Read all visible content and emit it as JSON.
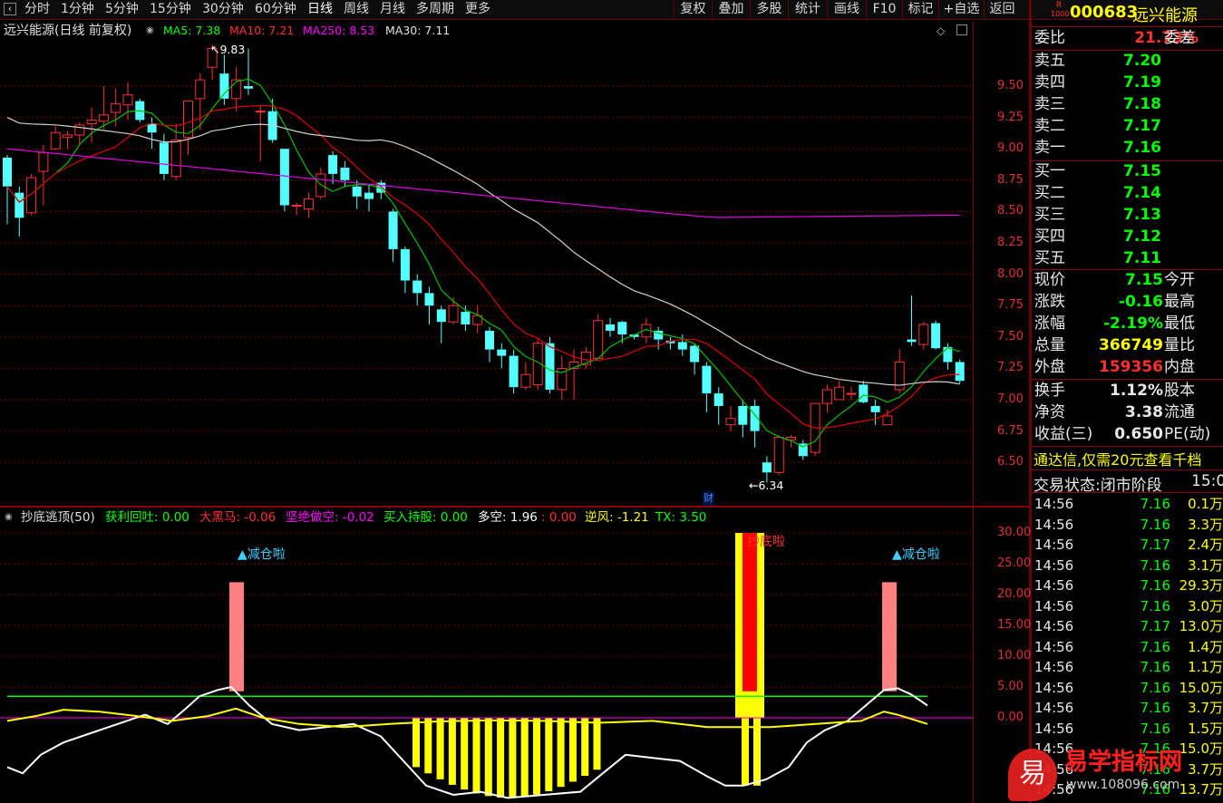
{
  "toolbar": {
    "periods": [
      "分时",
      "1分钟",
      "5分钟",
      "15分钟",
      "30分钟",
      "60分钟",
      "日线",
      "周线",
      "月线",
      "多周期",
      "更多"
    ],
    "active": "日线",
    "right_buttons": [
      "复权",
      "叠加",
      "多股",
      "统计",
      "画线",
      "F10",
      "标记",
      "+自选",
      "返回"
    ]
  },
  "main_chart": {
    "title": "远兴能源(日线 前复权)",
    "ma5": "MA5: 7.38",
    "ma10": "MA10: 7.21",
    "ma250": "MA250: 8.53",
    "ma30": "MA30: 7.11",
    "high_label": "9.83",
    "low_label": "6.34",
    "fin_marker": "财",
    "y_labels": [
      "9.50",
      "9.25",
      "9.00",
      "8.75",
      "8.50",
      "8.25",
      "8.00",
      "7.75",
      "7.50",
      "7.25",
      "7.00",
      "6.75",
      "6.50"
    ]
  },
  "indicator": {
    "title": "抄底逃顶(50)",
    "items": [
      {
        "text": "获利回吐: 0.00",
        "color": "#00ff00"
      },
      {
        "text": "大黑马: -0.06",
        "color": "#ff3030"
      },
      {
        "text": "坚绝做空: -0.02",
        "color": "#ff00ff"
      },
      {
        "text": "买入持股: 0.00",
        "color": "#00ff00"
      },
      {
        "text": "多空: 1.96",
        "color": "#ffffff"
      },
      {
        "text": ": 0.00",
        "color": "#ff3030"
      },
      {
        "text": "逆风: -1.21",
        "color": "#ffff00"
      },
      {
        "text": "TX: 3.50",
        "color": "#00ff00"
      }
    ],
    "signal_reduce": "减仓啦",
    "signal_bottom": "抄底啦",
    "y_labels": [
      "30.00",
      "25.00",
      "20.00",
      "15.00",
      "10.00",
      "5.00",
      "0.00"
    ]
  },
  "quote": {
    "badge_top": "R",
    "badge_bottom": "1000",
    "code": "000683",
    "name": "远兴能源",
    "weibi_label": "委比",
    "weibi_value": "21.73%",
    "weicha_label": "委差",
    "sell": [
      {
        "label": "卖五",
        "price": "7.20"
      },
      {
        "label": "卖四",
        "price": "7.19"
      },
      {
        "label": "卖三",
        "price": "7.18"
      },
      {
        "label": "卖二",
        "price": "7.17"
      },
      {
        "label": "卖一",
        "price": "7.16"
      }
    ],
    "buy": [
      {
        "label": "买一",
        "price": "7.15"
      },
      {
        "label": "买二",
        "price": "7.14"
      },
      {
        "label": "买三",
        "price": "7.13"
      },
      {
        "label": "买四",
        "price": "7.12"
      },
      {
        "label": "买五",
        "price": "7.11"
      }
    ],
    "stats": [
      {
        "k": "现价",
        "v": "7.15",
        "c": "#00ff00",
        "k2": "今开"
      },
      {
        "k": "涨跌",
        "v": "-0.16",
        "c": "#00ff00",
        "k2": "最高"
      },
      {
        "k": "涨幅",
        "v": "-2.19%",
        "c": "#00ff00",
        "k2": "最低"
      },
      {
        "k": "总量",
        "v": "366749",
        "c": "#ffff00",
        "k2": "量比"
      },
      {
        "k": "外盘",
        "v": "159356",
        "c": "#ff3030",
        "k2": "内盘"
      }
    ],
    "stats2": [
      {
        "k": "换手",
        "v": "1.12%",
        "c": "#e8e8e8",
        "k2": "股本"
      },
      {
        "k": "净资",
        "v": "3.38",
        "c": "#e8e8e8",
        "k2": "流通"
      },
      {
        "k": "收益(三)",
        "v": "0.650",
        "c": "#e8e8e8",
        "k2": "PE(动)"
      }
    ],
    "banner": "通达信,仅需20元查看千档",
    "status_label": "交易状态:",
    "status_value": "闭市阶段",
    "status_time": "15:0",
    "ticks": [
      {
        "t": "14:56",
        "p": "7.16",
        "v": "0.1万"
      },
      {
        "t": "14:56",
        "p": "7.16",
        "v": "3.3万"
      },
      {
        "t": "14:56",
        "p": "7.17",
        "v": "2.4万"
      },
      {
        "t": "14:56",
        "p": "7.16",
        "v": "3.1万"
      },
      {
        "t": "14:56",
        "p": "7.16",
        "v": "29.3万"
      },
      {
        "t": "14:56",
        "p": "7.16",
        "v": "3.0万"
      },
      {
        "t": "14:56",
        "p": "7.17",
        "v": "13.0万"
      },
      {
        "t": "14:56",
        "p": "7.16",
        "v": "1.4万"
      },
      {
        "t": "14:56",
        "p": "7.16",
        "v": "1.1万"
      },
      {
        "t": "14:56",
        "p": "7.16",
        "v": "15.0万"
      },
      {
        "t": "14:56",
        "p": "7.16",
        "v": "3.7万"
      },
      {
        "t": "14:56",
        "p": "7.16",
        "v": "1.5万"
      },
      {
        "t": "14:56",
        "p": "7.16",
        "v": "15.0万"
      },
      {
        "t": "14:56",
        "p": "7.16",
        "v": "3.7万"
      },
      {
        "t": "14:56",
        "p": "7.16",
        "v": "13.7万"
      }
    ]
  },
  "watermark": {
    "text": "易学指标网",
    "url": "www.108096.com",
    "logo": "易"
  },
  "chart_data": {
    "type": "candlestick",
    "ylim": [
      6.3,
      9.9
    ],
    "candles": [
      [
        8.93,
        8.7,
        8.95,
        8.4
      ],
      [
        8.65,
        8.45,
        8.7,
        8.3
      ],
      [
        8.49,
        8.77,
        8.8,
        8.47
      ],
      [
        8.82,
        8.97,
        9.03,
        8.55
      ],
      [
        9.0,
        9.13,
        9.18,
        8.99
      ],
      [
        9.09,
        9.11,
        9.14,
        9.0
      ],
      [
        9.11,
        9.19,
        9.21,
        9.03
      ],
      [
        9.2,
        9.23,
        9.33,
        9.05
      ],
      [
        9.22,
        9.27,
        9.5,
        9.16
      ],
      [
        9.29,
        9.36,
        9.48,
        9.18
      ],
      [
        9.35,
        9.43,
        9.53,
        9.23
      ],
      [
        9.38,
        9.23,
        9.4,
        9.21
      ],
      [
        9.2,
        9.13,
        9.25,
        9.0
      ],
      [
        9.05,
        8.8,
        9.12,
        8.75
      ],
      [
        8.78,
        9.07,
        9.2,
        8.75
      ],
      [
        9.09,
        9.38,
        9.38,
        8.95
      ],
      [
        9.4,
        9.55,
        9.6,
        9.15
      ],
      [
        9.65,
        9.8,
        9.83,
        9.55
      ],
      [
        9.6,
        9.4,
        9.75,
        9.35
      ],
      [
        9.4,
        9.55,
        9.65,
        9.3
      ],
      [
        9.5,
        9.48,
        9.8,
        9.43
      ],
      [
        9.3,
        9.3,
        9.35,
        8.9
      ],
      [
        9.3,
        9.07,
        9.4,
        9.05
      ],
      [
        9.0,
        8.55,
        9.0,
        8.5
      ],
      [
        8.55,
        8.55,
        8.57,
        8.47
      ],
      [
        8.52,
        8.6,
        8.65,
        8.45
      ],
      [
        8.62,
        8.8,
        8.85,
        8.6
      ],
      [
        8.95,
        8.8,
        8.98,
        8.72
      ],
      [
        8.85,
        8.75,
        8.9,
        8.7
      ],
      [
        8.7,
        8.62,
        8.75,
        8.52
      ],
      [
        8.65,
        8.6,
        8.72,
        8.5
      ],
      [
        8.73,
        8.65,
        8.75,
        8.6
      ],
      [
        8.5,
        8.2,
        8.52,
        8.1
      ],
      [
        8.2,
        7.95,
        8.22,
        7.85
      ],
      [
        7.95,
        7.85,
        8.0,
        7.75
      ],
      [
        7.85,
        7.75,
        7.9,
        7.6
      ],
      [
        7.72,
        7.62,
        7.75,
        7.45
      ],
      [
        7.62,
        7.75,
        7.82,
        7.6
      ],
      [
        7.7,
        7.6,
        7.75,
        7.55
      ],
      [
        7.6,
        7.67,
        7.75,
        7.53
      ],
      [
        7.55,
        7.4,
        7.58,
        7.3
      ],
      [
        7.4,
        7.35,
        7.45,
        7.25
      ],
      [
        7.35,
        7.1,
        7.4,
        7.05
      ],
      [
        7.1,
        7.2,
        7.3,
        7.08
      ],
      [
        7.12,
        7.45,
        7.48,
        7.08
      ],
      [
        7.45,
        7.08,
        7.5,
        7.05
      ],
      [
        7.08,
        7.25,
        7.35,
        7.0
      ],
      [
        7.25,
        7.3,
        7.4,
        7.0
      ],
      [
        7.28,
        7.38,
        7.42,
        7.25
      ],
      [
        7.33,
        7.63,
        7.68,
        7.33
      ],
      [
        7.6,
        7.55,
        7.65,
        7.5
      ],
      [
        7.62,
        7.52,
        7.63,
        7.45
      ],
      [
        7.52,
        7.5,
        7.52,
        7.48
      ],
      [
        7.5,
        7.6,
        7.65,
        7.45
      ],
      [
        7.55,
        7.48,
        7.58,
        7.4
      ],
      [
        7.47,
        7.45,
        7.5,
        7.4
      ],
      [
        7.46,
        7.4,
        7.52,
        7.35
      ],
      [
        7.43,
        7.3,
        7.45,
        7.2
      ],
      [
        7.27,
        7.05,
        7.3,
        6.9
      ],
      [
        7.05,
        6.95,
        7.1,
        6.8
      ],
      [
        6.8,
        6.85,
        6.95,
        6.75
      ],
      [
        6.95,
        6.8,
        7.0,
        6.7
      ],
      [
        6.95,
        6.75,
        7.0,
        6.62
      ],
      [
        6.5,
        6.42,
        6.55,
        6.34
      ],
      [
        6.42,
        6.7,
        6.72,
        6.4
      ],
      [
        6.68,
        6.7,
        6.72,
        6.62
      ],
      [
        6.65,
        6.55,
        6.68,
        6.52
      ],
      [
        6.58,
        6.97,
        6.97,
        6.55
      ],
      [
        6.97,
        7.08,
        7.12,
        6.9
      ],
      [
        7.0,
        7.1,
        7.15,
        7.02
      ],
      [
        7.05,
        7.05,
        7.1,
        7.0
      ],
      [
        7.12,
        6.98,
        7.15,
        6.97
      ],
      [
        6.95,
        6.9,
        7.0,
        6.8
      ],
      [
        6.8,
        6.87,
        6.92,
        6.8
      ],
      [
        7.08,
        7.3,
        7.4,
        7.05
      ],
      [
        7.48,
        7.46,
        7.83,
        7.43
      ],
      [
        7.44,
        7.6,
        7.62,
        7.4
      ],
      [
        7.61,
        7.41,
        7.63,
        7.4
      ],
      [
        7.42,
        7.3,
        7.45,
        7.24
      ],
      [
        7.3,
        7.15,
        7.32,
        7.13
      ]
    ],
    "ma_series": [
      "MA5",
      "MA10",
      "MA30",
      "MA250"
    ],
    "indicator_ylim": [
      -13,
      30
    ]
  }
}
